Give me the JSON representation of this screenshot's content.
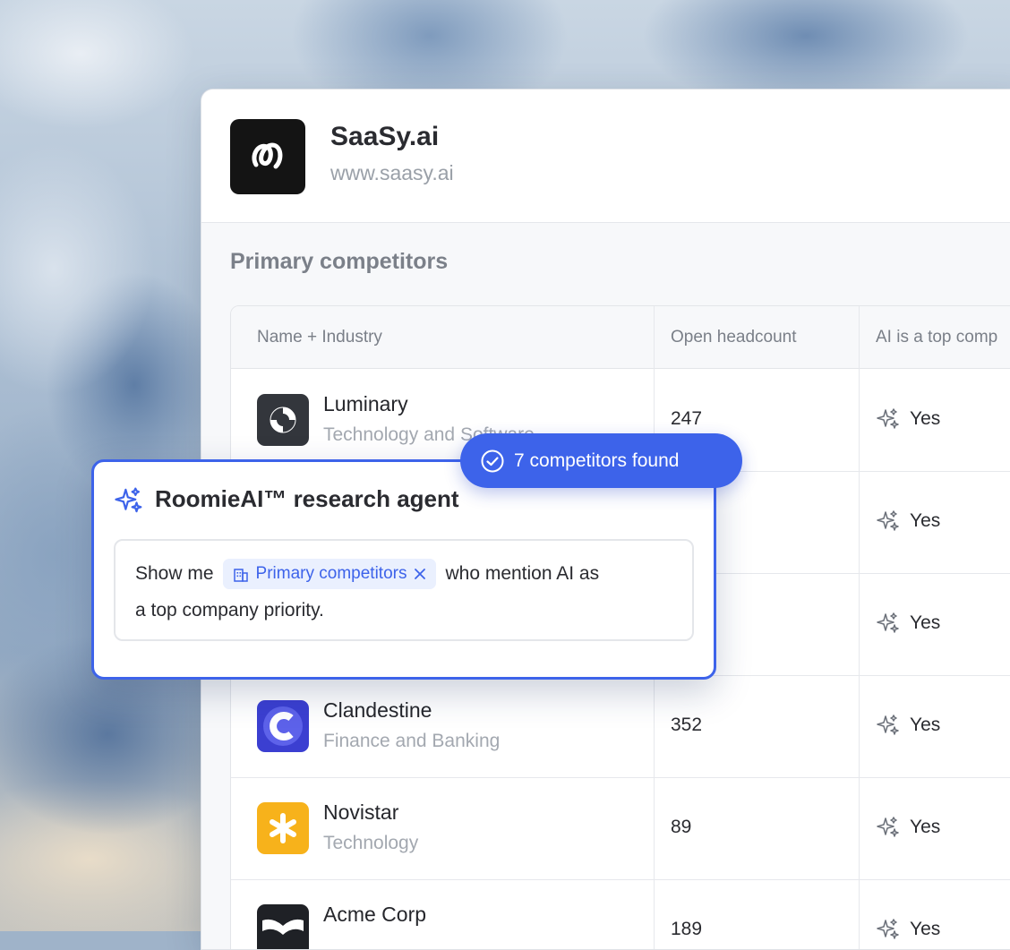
{
  "company": {
    "name": "SaaSy.ai",
    "url": "www.saasy.ai"
  },
  "section_title": "Primary competitors",
  "table": {
    "columns": [
      "Name + Industry",
      "Open headcount",
      "AI is a top comp"
    ],
    "rows": [
      {
        "name": "Luminary",
        "industry": "Technology and Software",
        "headcount": "247",
        "ai": "Yes",
        "logo_color": "#33363c",
        "logo_icon": "ring-icon"
      },
      {
        "name": "",
        "industry": "",
        "headcount": "",
        "ai": "Yes"
      },
      {
        "name": "",
        "industry": "",
        "headcount": "",
        "ai": "Yes"
      },
      {
        "name": "Clandestine",
        "industry": "Finance and Banking",
        "headcount": "352",
        "ai": "Yes",
        "logo_color": "#3b3fd1",
        "logo_icon": "c-letter-icon"
      },
      {
        "name": "Novistar",
        "industry": "Technology",
        "headcount": "89",
        "ai": "Yes",
        "logo_color": "#f7b21b",
        "logo_icon": "asterisk-icon"
      },
      {
        "name": "Acme Corp",
        "industry": "",
        "headcount": "189",
        "ai": "Yes",
        "logo_color": "#1f2126",
        "logo_icon": "wing-icon"
      }
    ]
  },
  "agent": {
    "title": "RoomieAI™ research agent",
    "prompt_before": "Show me",
    "chip_label": "Primary competitors",
    "prompt_after": "who mention AI as",
    "prompt_line2": "a top company priority."
  },
  "status_pill": {
    "text": "7 competitors found"
  },
  "colors": {
    "accent": "#3d63ea",
    "chip_bg": "#eaf0fe"
  }
}
